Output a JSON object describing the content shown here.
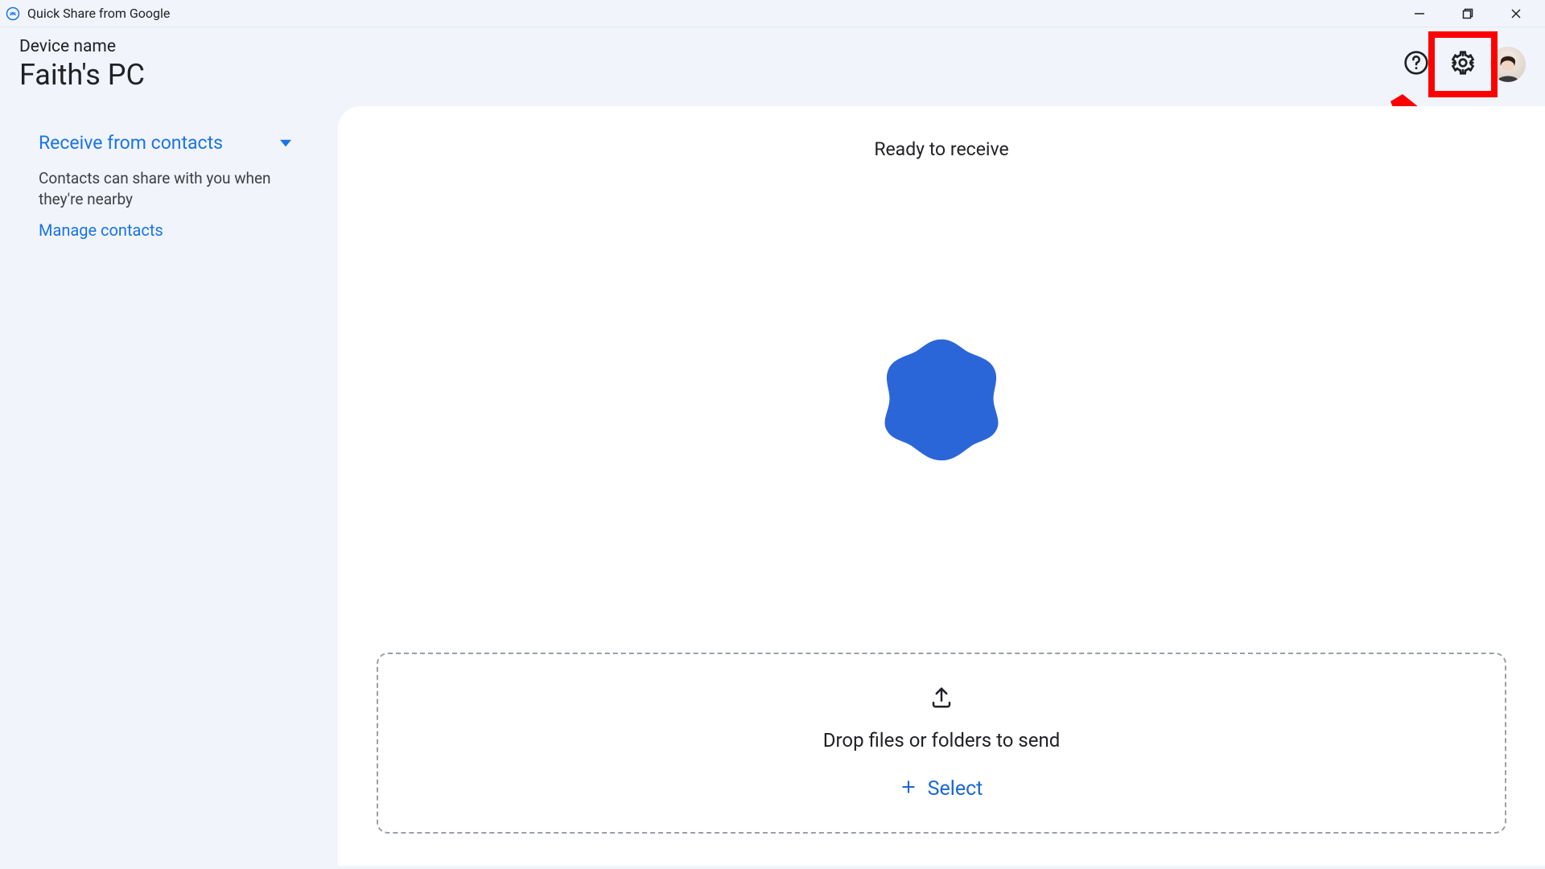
{
  "app": {
    "title": "Quick Share from Google"
  },
  "header": {
    "device_label": "Device name",
    "device_name": "Faith's PC"
  },
  "sidebar": {
    "receive_mode": "Receive from contacts",
    "receive_description": "Contacts can share with you when they're nearby",
    "manage_contacts": "Manage contacts"
  },
  "main": {
    "status": "Ready to receive",
    "dropzone_text": "Drop files or folders to send",
    "select_label": "Select"
  },
  "colors": {
    "accent_blue": "#1a73e8",
    "blob_blue": "#225fd4",
    "highlight_red": "#ff0000"
  },
  "annotation": {
    "highlight_target": "settings-button"
  }
}
